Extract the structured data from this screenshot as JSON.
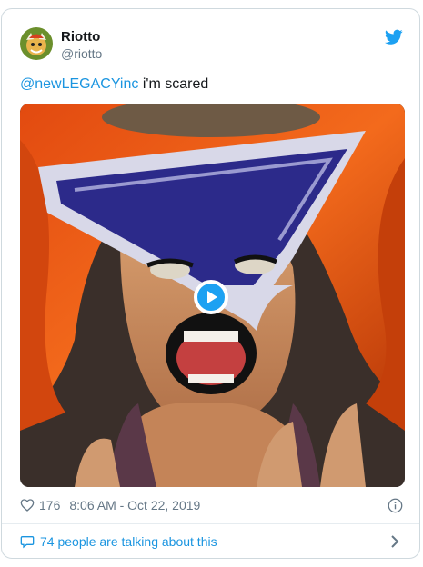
{
  "author": {
    "name": "Riotto",
    "handle": "@riotto"
  },
  "tweet": {
    "mention": "@newLEGACYinc",
    "text": "i'm scared"
  },
  "media": {
    "type": "video",
    "description_icon": "play-icon"
  },
  "footer": {
    "likes": "176",
    "timestamp": "8:06 AM - Oct 22, 2019",
    "conversation": "74 people are talking about this"
  },
  "colors": {
    "accent": "#1da1f2",
    "link": "#1b95e0",
    "muted": "#657786",
    "border": "#cfd9de"
  },
  "icons": [
    "twitter-bird-icon",
    "heart-icon",
    "info-icon",
    "speech-bubble-icon",
    "chevron-right-icon",
    "play-icon"
  ]
}
